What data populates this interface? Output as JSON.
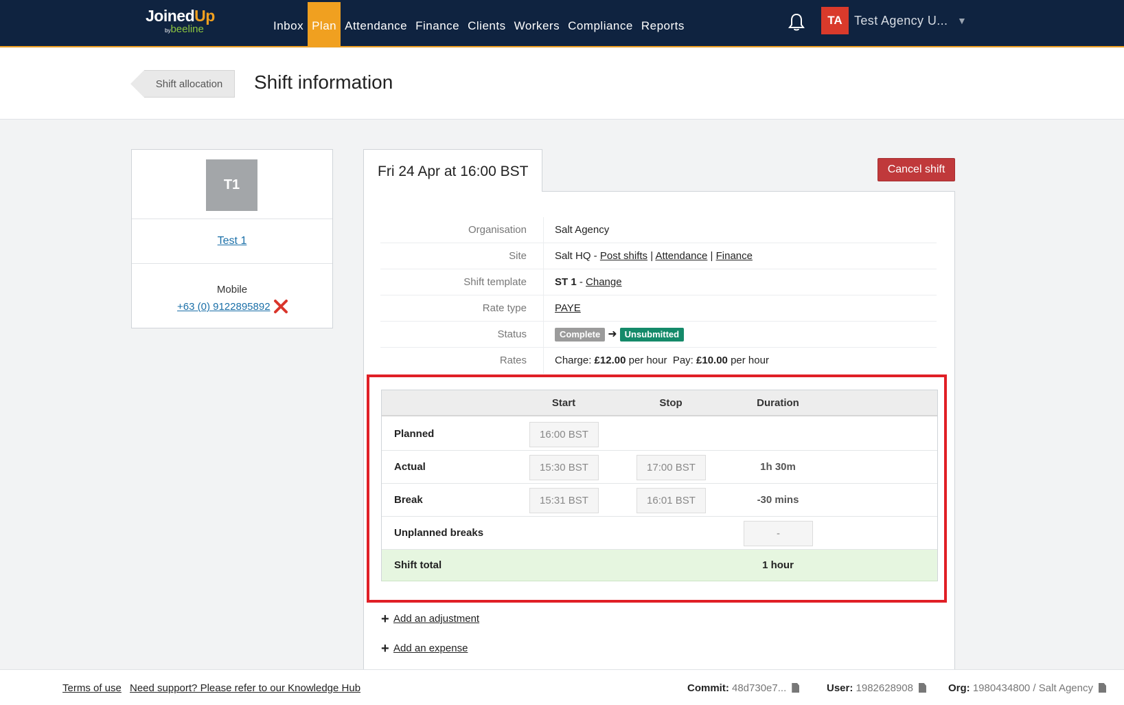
{
  "nav": {
    "logo_main_a": "Joined",
    "logo_main_b": "Up",
    "logo_by": "by",
    "logo_sub": "beeline",
    "items": [
      {
        "label": "Inbox"
      },
      {
        "label": "Plan"
      },
      {
        "label": "Attendance"
      },
      {
        "label": "Finance"
      },
      {
        "label": "Clients"
      },
      {
        "label": "Workers"
      },
      {
        "label": "Compliance"
      },
      {
        "label": "Reports"
      }
    ],
    "active_item": "Plan",
    "user_initials": "TA",
    "user_name": "Test Agency U...",
    "accent_color": "#f0a020",
    "bar_color": "#0f2340"
  },
  "header": {
    "breadcrumb": "Shift allocation",
    "title": "Shift information"
  },
  "worker": {
    "initials": "T1",
    "name": "Test 1",
    "mobile_label": "Mobile",
    "phone": "+63 (0) 9122895892"
  },
  "shift": {
    "tab_title": "Fri 24 Apr at 16:00 BST",
    "cancel_label": "Cancel shift",
    "info": {
      "organisation_label": "Organisation",
      "organisation_value": "Salt Agency",
      "site_label": "Site",
      "site_value": "Salt HQ - ",
      "site_link_post": "Post shifts",
      "site_link_attendance": "Attendance",
      "site_link_finance": "Finance",
      "sep": " | ",
      "template_label": "Shift template",
      "template_value": "ST 1",
      "template_dash": " - ",
      "template_change": "Change",
      "rate_type_label": "Rate type",
      "rate_type_value": "PAYE",
      "status_label": "Status",
      "status_from": "Complete",
      "status_to": "Unsubmitted",
      "rates_label": "Rates",
      "charge_label": "Charge: ",
      "charge_value": "£12.00",
      "charge_unit": " per hour",
      "pay_label": "Pay: ",
      "pay_value": "£10.00",
      "pay_unit": " per hour"
    },
    "times": {
      "headers": {
        "start": "Start",
        "stop": "Stop",
        "duration": "Duration"
      },
      "planned": {
        "label": "Planned",
        "start": "16:00 BST"
      },
      "actual": {
        "label": "Actual",
        "start": "15:30 BST",
        "stop": "17:00 BST",
        "duration": "1h 30m"
      },
      "break": {
        "label": "Break",
        "start": "15:31 BST",
        "stop": "16:01 BST",
        "duration": "-30 mins"
      },
      "unplanned": {
        "label": "Unplanned breaks",
        "value": "-"
      },
      "total": {
        "label": "Shift total",
        "value": "1 hour"
      }
    },
    "add_adjustment": "Add an adjustment",
    "add_expense": "Add an expense"
  },
  "footer": {
    "terms": "Terms of use",
    "support": "Need support? Please refer to our Knowledge Hub",
    "commit_label": "Commit:",
    "commit_value": "48d730e7...",
    "user_label": "User:",
    "user_value": "1982628908",
    "org_label": "Org:",
    "org_value": "1980434800 / Salt Agency"
  }
}
